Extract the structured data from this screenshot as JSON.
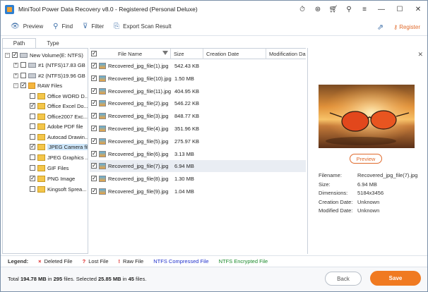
{
  "window": {
    "title": "MiniTool Power Data Recovery v8.0 - Registered (Personal Deluxe)"
  },
  "toolbar": {
    "preview": "Preview",
    "find": "Find",
    "filter": "Filter",
    "export": "Export Scan Result",
    "register": "Register"
  },
  "tabs": {
    "path": "Path",
    "type": "Type"
  },
  "tree": {
    "volume": "New Volume(E: NTFS)",
    "p1": "#1 (NTFS)17.83 GB",
    "p2": "#2 (NTFS)19.96 GB",
    "raw": "RAW Files",
    "items": [
      "Office WORD D...",
      "Office Excel Do...",
      "Office2007 Exc...",
      "Adobe PDF file",
      "Autocad Drawin...",
      "JPEG Camera file",
      "JPEG Graphics ...",
      "GIF Files",
      "PNG Image",
      "Kingsoft Sprea..."
    ]
  },
  "list": {
    "headers": {
      "name": "File Name",
      "size": "Size",
      "created": "Creation Date",
      "modified": "Modification Da"
    },
    "rows": [
      {
        "name": "Recovered_jpg_file(1).jpg",
        "size": "542.43 KB"
      },
      {
        "name": "Recovered_jpg_file(10).jpg",
        "size": "1.50 MB"
      },
      {
        "name": "Recovered_jpg_file(11).jpg",
        "size": "404.95 KB"
      },
      {
        "name": "Recovered_jpg_file(2).jpg",
        "size": "546.22 KB"
      },
      {
        "name": "Recovered_jpg_file(3).jpg",
        "size": "848.77 KB"
      },
      {
        "name": "Recovered_jpg_file(4).jpg",
        "size": "351.96 KB"
      },
      {
        "name": "Recovered_jpg_file(5).jpg",
        "size": "275.97 KB"
      },
      {
        "name": "Recovered_jpg_file(6).jpg",
        "size": "3.13 MB"
      },
      {
        "name": "Recovered_jpg_file(7).jpg",
        "size": "6.94 MB"
      },
      {
        "name": "Recovered_jpg_file(8).jpg",
        "size": "1.30 MB"
      },
      {
        "name": "Recovered_jpg_file(9).jpg",
        "size": "1.04 MB"
      }
    ]
  },
  "preview": {
    "button": "Preview",
    "filename_label": "Filename:",
    "filename": "Recovered_jpg_file(7).jpg",
    "size_label": "Size:",
    "size": "6.94 MB",
    "dimensions_label": "Dimensions:",
    "dimensions": "5184x3456",
    "created_label": "Creation Date:",
    "created": "Unknown",
    "modified_label": "Modified Date:",
    "modified": "Unknown"
  },
  "legend": {
    "title": "Legend:",
    "deleted": "Deleted File",
    "lost": "Lost File",
    "raw": "Raw File",
    "ntfs_compressed": "NTFS Compressed File",
    "ntfs_encrypted": "NTFS Encrypted File",
    "colors": {
      "deleted": "#d22",
      "lost": "#d22",
      "raw": "#d22",
      "ntfs_compressed": "#2233cc",
      "ntfs_encrypted": "#1a8a2a"
    }
  },
  "status": {
    "total_prefix": "Total ",
    "total_size": "194.78 MB",
    "in": " in ",
    "total_files": "295",
    "files_sel": " files.  Selected ",
    "sel_size": "25.85 MB",
    "in2": " in ",
    "sel_files": "45",
    "files_end": " files."
  },
  "buttons": {
    "back": "Back",
    "save": "Save"
  }
}
